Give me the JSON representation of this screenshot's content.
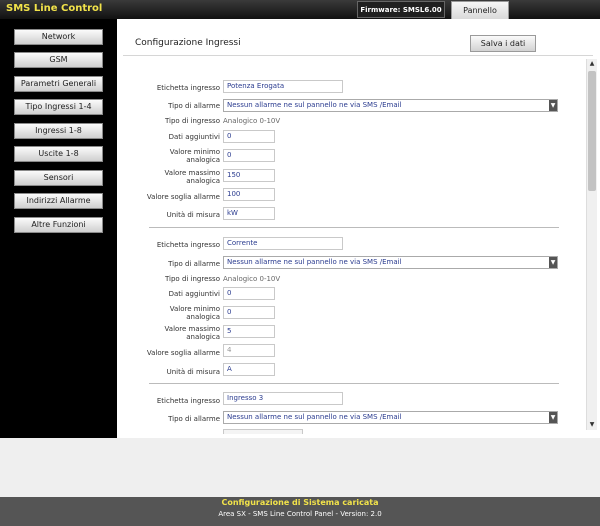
{
  "header": {
    "app_title": "SMS Line Control",
    "firmware": "Firmware: SMSL6.00",
    "tab_label": "Pannello"
  },
  "sidebar": {
    "items": [
      {
        "label": "Network"
      },
      {
        "label": "GSM"
      },
      {
        "label": "Parametri Generali"
      },
      {
        "label": "Tipo Ingressi 1-4"
      },
      {
        "label": "Ingressi 1-8"
      },
      {
        "label": "Uscite 1-8"
      },
      {
        "label": "Sensori"
      },
      {
        "label": "Indirizzi Allarme"
      },
      {
        "label": "Altre Funzioni"
      }
    ]
  },
  "main": {
    "title": "Configurazione Ingressi",
    "save_label": "Salva i dati"
  },
  "labels": {
    "etichetta": "Etichetta ingresso",
    "tipo_allarme": "Tipo di allarme",
    "tipo_ingresso": "Tipo di ingresso",
    "dati_aggiuntivi": "Dati aggiuntivi",
    "valore_minimo_1": "Valore minimo",
    "valore_minimo_2": "analogica",
    "valore_massimo_1": "Valore massimo",
    "valore_massimo_2": "analogica",
    "valore_soglia": "Valore soglia allarme",
    "unita": "Unità di misura"
  },
  "inputs": [
    {
      "label_value": "Potenza Erogata",
      "alarm_type": "Nessun allarme ne sul pannello ne via SMS /Email",
      "input_type": "Analogico 0-10V",
      "extra_data": "0",
      "min_value": "0",
      "max_value": "150",
      "threshold": "100",
      "unit": "kW"
    },
    {
      "label_value": "Corrente",
      "alarm_type": "Nessun allarme ne sul pannello ne via SMS /Email",
      "input_type": "Analogico 0-10V",
      "extra_data": "0",
      "min_value": "0",
      "max_value": "5",
      "threshold": "4",
      "unit": "A"
    },
    {
      "label_value": "Ingresso 3",
      "alarm_type": "Nessun allarme ne sul pannello ne via SMS /Email"
    }
  ],
  "footer": {
    "status": "Configurazione di Sistema caricata",
    "copyright": "Area SX - SMS Line Control Panel - Version: 2.0"
  },
  "colors": {
    "title_yellow": "#f2e34a",
    "field_text": "#2a3b8f"
  }
}
